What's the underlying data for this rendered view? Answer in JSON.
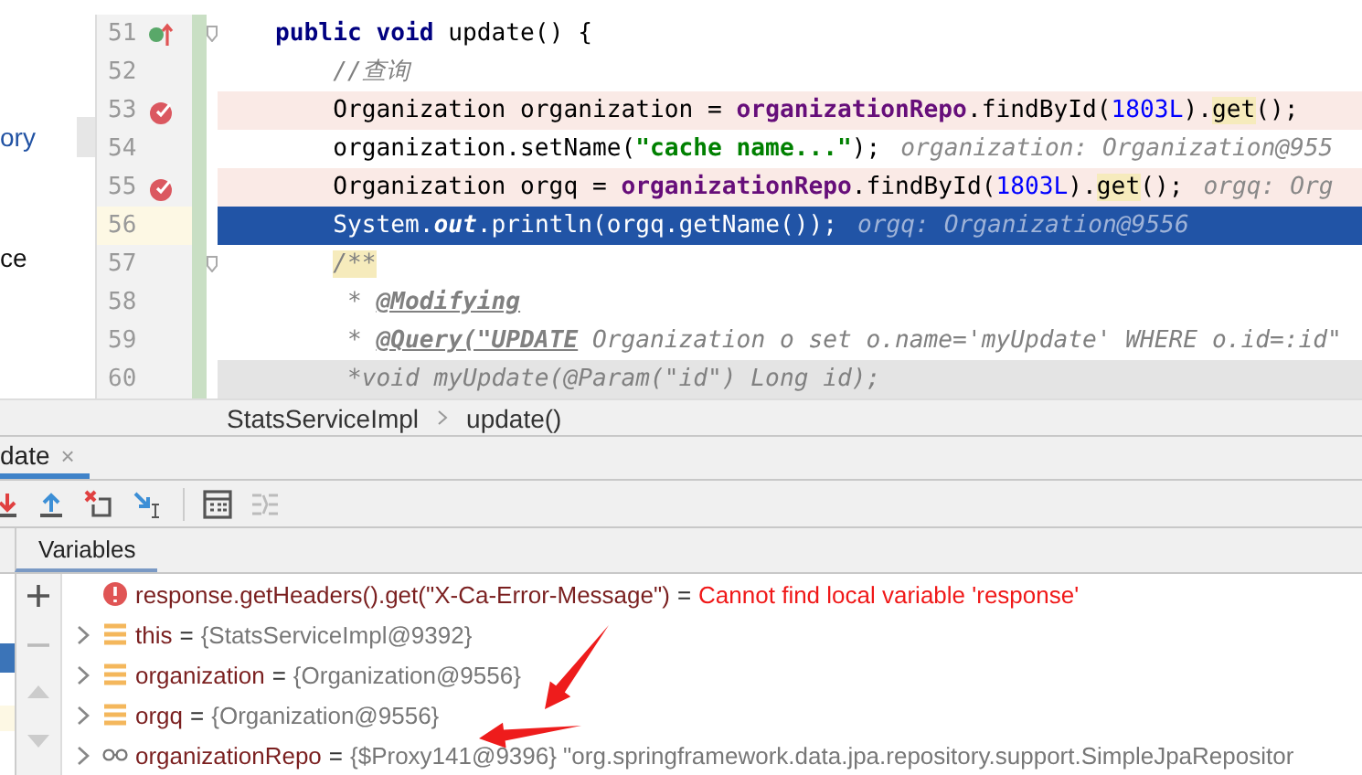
{
  "project_tree": {
    "items": [
      {
        "label": "ory",
        "selected": true
      },
      {
        "label": "ce",
        "selected": false
      }
    ]
  },
  "editor": {
    "lines": [
      {
        "number": "51",
        "kind": "signature",
        "override": true,
        "breakpoint": false,
        "current": false,
        "covered": false,
        "fold": true,
        "tokens": [
          {
            "kind": "keyword",
            "text": "public void"
          },
          {
            "kind": "plain",
            "text": " update() {"
          }
        ]
      },
      {
        "number": "52",
        "kind": "body",
        "override": false,
        "breakpoint": false,
        "current": false,
        "covered": false,
        "fold": false,
        "tokens": [
          {
            "kind": "comment",
            "text": "//查询"
          }
        ]
      },
      {
        "number": "53",
        "kind": "body",
        "override": false,
        "breakpoint": true,
        "current": false,
        "covered": false,
        "fold": false,
        "tokens": [
          {
            "kind": "plain",
            "text": "Organization organization = "
          },
          {
            "kind": "field",
            "text": "organizationRepo"
          },
          {
            "kind": "plain",
            "text": ".findById("
          },
          {
            "kind": "number",
            "text": "1803L"
          },
          {
            "kind": "plain",
            "text": ")."
          },
          {
            "kind": "match",
            "text": "get"
          },
          {
            "kind": "plain",
            "text": "();"
          }
        ]
      },
      {
        "number": "54",
        "kind": "body",
        "override": false,
        "breakpoint": false,
        "current": false,
        "covered": false,
        "fold": false,
        "tokens": [
          {
            "kind": "plain",
            "text": "organization.setName("
          },
          {
            "kind": "string",
            "text": "\"cache name...\""
          },
          {
            "kind": "plain",
            "text": ");"
          },
          {
            "kind": "hint",
            "text": "organization: Organization@955"
          }
        ]
      },
      {
        "number": "55",
        "kind": "body",
        "override": false,
        "breakpoint": true,
        "current": false,
        "covered": false,
        "fold": false,
        "tokens": [
          {
            "kind": "plain",
            "text": "Organization orgq = "
          },
          {
            "kind": "field",
            "text": "organizationRepo"
          },
          {
            "kind": "plain",
            "text": ".findById("
          },
          {
            "kind": "number",
            "text": "1803L"
          },
          {
            "kind": "plain",
            "text": ")."
          },
          {
            "kind": "match",
            "text": "get"
          },
          {
            "kind": "plain",
            "text": "();"
          },
          {
            "kind": "hint",
            "text": "orgq: Org"
          }
        ]
      },
      {
        "number": "56",
        "kind": "body",
        "override": false,
        "breakpoint": false,
        "current": true,
        "covered": false,
        "fold": false,
        "tokens": [
          {
            "kind": "plain",
            "text": "System."
          },
          {
            "kind": "static",
            "text": "out"
          },
          {
            "kind": "plain",
            "text": ".println(orgq.getName());"
          },
          {
            "kind": "hint",
            "text": "orgq: Organization@9556"
          }
        ]
      },
      {
        "number": "57",
        "kind": "body",
        "override": false,
        "breakpoint": false,
        "current": false,
        "covered": false,
        "fold": true,
        "tokens": [
          {
            "kind": "doc_match",
            "text": "/**"
          }
        ]
      },
      {
        "number": "58",
        "kind": "body",
        "override": false,
        "breakpoint": false,
        "current": false,
        "covered": false,
        "fold": false,
        "tokens": [
          {
            "kind": "doc",
            "text": " * "
          },
          {
            "kind": "doc_tag",
            "text": "@Modifying"
          }
        ]
      },
      {
        "number": "59",
        "kind": "body",
        "override": false,
        "breakpoint": false,
        "current": false,
        "covered": false,
        "fold": false,
        "tokens": [
          {
            "kind": "doc",
            "text": " * "
          },
          {
            "kind": "doc_tag",
            "text": "@Query(\"UPDATE"
          },
          {
            "kind": "doc",
            "text": " Organization o set o.name='myUpdate' WHERE o.id=:id\""
          }
        ]
      },
      {
        "number": "60",
        "kind": "body",
        "override": false,
        "breakpoint": false,
        "current": false,
        "covered": true,
        "fold": false,
        "tokens": [
          {
            "kind": "doc",
            "text": " *void myUpdate(@Param(\"id\") Long id);"
          }
        ]
      }
    ]
  },
  "breadcrumb": [
    "StatsServiceImpl",
    "update()"
  ],
  "debug": {
    "tab": {
      "label": "date",
      "close": "×",
      "selected": true
    },
    "variables_tab": {
      "label": "Variables",
      "selected": true
    },
    "variables": [
      {
        "kind": "error",
        "name": "response.getHeaders().get(\"X-Ca-Error-Message\")",
        "operator": "=",
        "value": "Cannot find local variable 'response'"
      },
      {
        "kind": "field",
        "name": "this",
        "operator": "=",
        "value": "{StatsServiceImpl@9392}"
      },
      {
        "kind": "field",
        "name": "organization",
        "operator": "=",
        "value": "{Organization@9556}"
      },
      {
        "kind": "field",
        "name": "orgq",
        "operator": "=",
        "value": "{Organization@9556}"
      },
      {
        "kind": "watch",
        "name": "organizationRepo",
        "operator": "=",
        "value": "{$Proxy141@9396} \"org.springframework.data.jpa.repository.support.SimpleJpaRepositor"
      }
    ]
  }
}
